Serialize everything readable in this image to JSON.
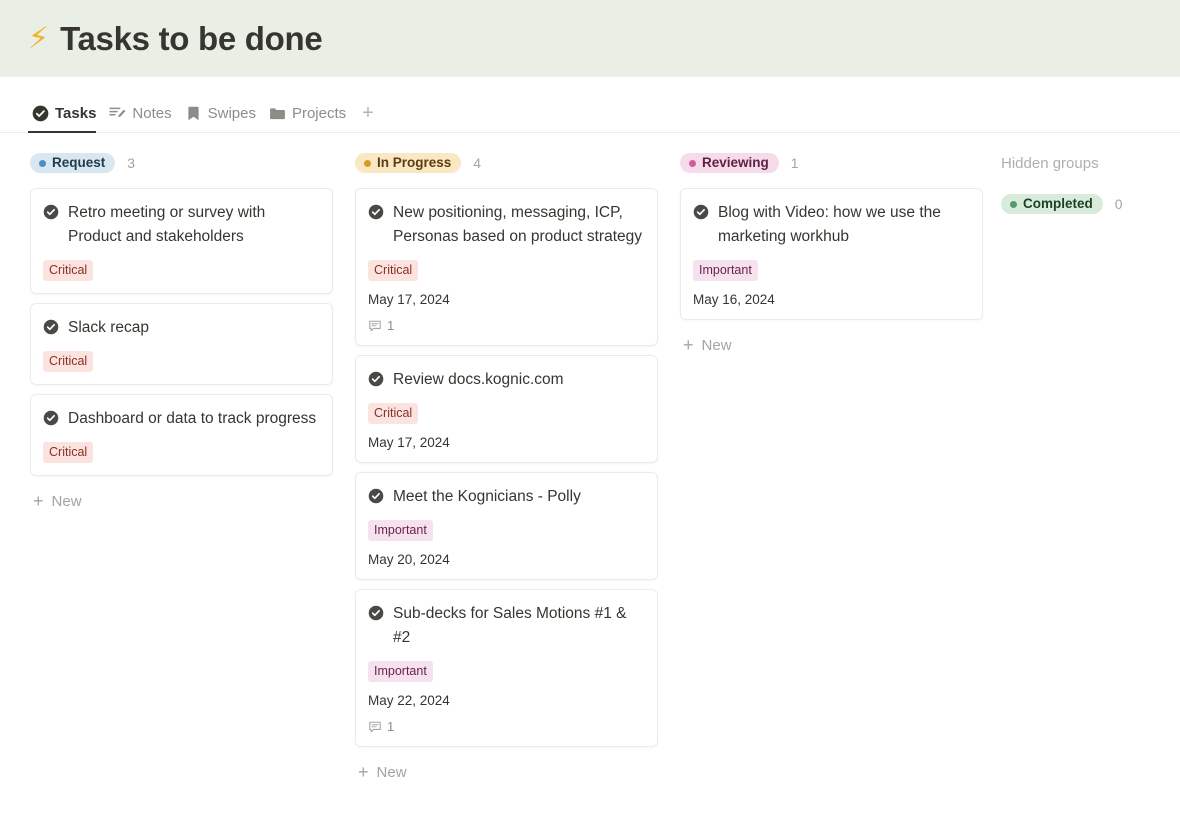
{
  "page": {
    "emoji": "⚡",
    "title": "Tasks to be done"
  },
  "tabs": [
    {
      "label": "Tasks",
      "icon": "check-circle-icon",
      "active": true
    },
    {
      "label": "Notes",
      "icon": "notes-pencil-icon",
      "active": false
    },
    {
      "label": "Swipes",
      "icon": "bookmark-icon",
      "active": false
    },
    {
      "label": "Projects",
      "icon": "folder-icon",
      "active": false
    }
  ],
  "tab_add_label": "+",
  "new_button_label": "New",
  "hidden_groups": {
    "label": "Hidden groups",
    "groups": [
      {
        "name": "Completed",
        "count": "0",
        "pill_bg": "#d9ecdc",
        "pill_text": "#1f4025",
        "dot": "#4f9d69"
      }
    ]
  },
  "columns": [
    {
      "name": "Request",
      "count": "3",
      "pill_bg": "#d8e7f0",
      "pill_text": "#1f3b4d",
      "dot": "#4a8ec2",
      "cards": [
        {
          "title": "Retro meeting or survey with Product and stakeholders",
          "tag": "Critical",
          "tag_kind": "critical",
          "date": "",
          "comments": ""
        },
        {
          "title": "Slack recap",
          "tag": "Critical",
          "tag_kind": "critical",
          "date": "",
          "comments": ""
        },
        {
          "title": "Dashboard or data to track progress",
          "tag": "Critical",
          "tag_kind": "critical",
          "date": "",
          "comments": ""
        }
      ]
    },
    {
      "name": "In Progress",
      "count": "4",
      "pill_bg": "#fae7c3",
      "pill_text": "#5c3d0d",
      "dot": "#d59a2a",
      "cards": [
        {
          "title": "New positioning, messaging, ICP, Personas based on product strategy",
          "tag": "Critical",
          "tag_kind": "critical",
          "date": "May 17, 2024",
          "comments": "1"
        },
        {
          "title": "Review docs.kognic.com",
          "tag": "Critical",
          "tag_kind": "critical",
          "date": "May 17, 2024",
          "comments": ""
        },
        {
          "title": "Meet the Kognicians - Polly",
          "tag": "Important",
          "tag_kind": "important",
          "date": "May 20, 2024",
          "comments": ""
        },
        {
          "title": "Sub-decks for Sales Motions #1 & #2",
          "tag": "Important",
          "tag_kind": "important",
          "date": "May 22, 2024",
          "comments": "1"
        }
      ]
    },
    {
      "name": "Reviewing",
      "count": "1",
      "pill_bg": "#f6dceb",
      "pill_text": "#5e1f44",
      "dot": "#cf5b9a",
      "cards": [
        {
          "title": "Blog with Video: how we use the marketing workhub",
          "tag": "Important",
          "tag_kind": "important",
          "date": "May 16, 2024",
          "comments": ""
        }
      ]
    }
  ]
}
